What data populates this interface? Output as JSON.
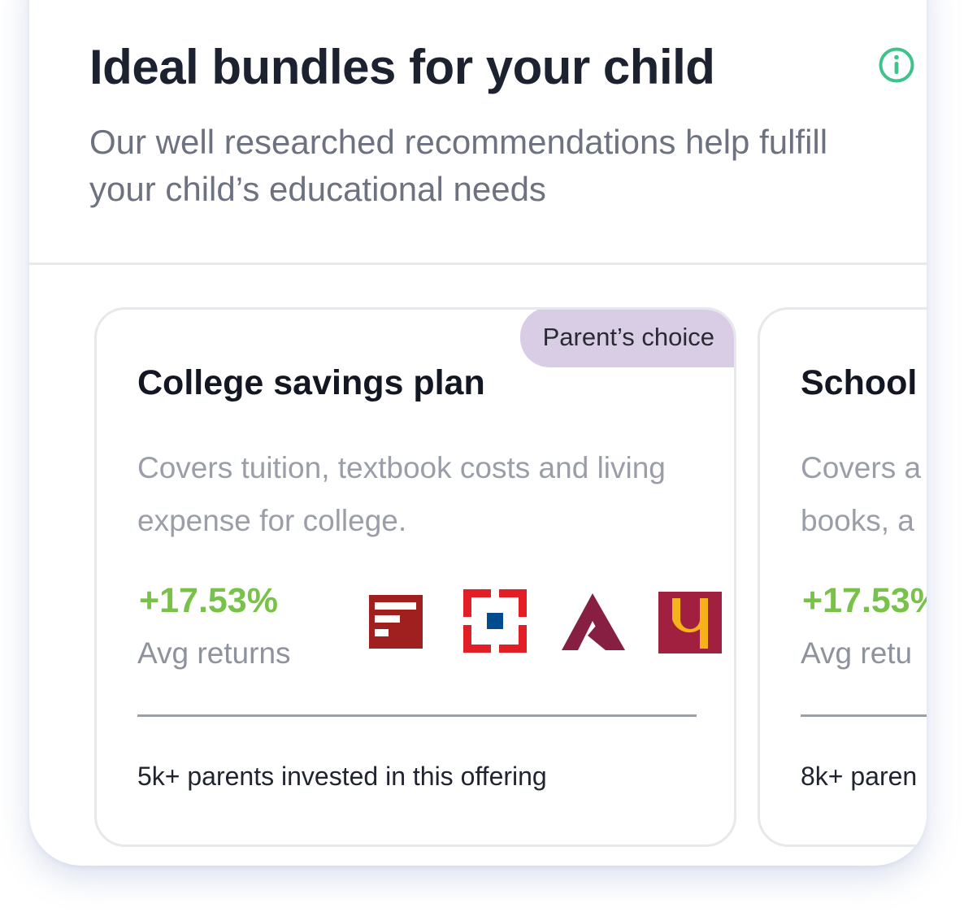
{
  "header": {
    "title": "Ideal bundles for your child",
    "subtitle": "Our well researched recommendations help fulfill your child’s educational needs",
    "info_icon": "info-circle-icon",
    "info_icon_color": "#3fc38a"
  },
  "cards": [
    {
      "badge": "Parent’s choice",
      "title": "College savings plan",
      "description": "Covers tuition, textbook costs and living expense for college.",
      "return_value": "+17.53%",
      "return_label": "Avg returns",
      "fund_logos": [
        "franklin-logo-icon",
        "hdfc-logo-icon",
        "axis-logo-icon",
        "pnb-logo-icon"
      ],
      "investors": "5k+ parents invested in this offering"
    },
    {
      "title": "School",
      "description_lines": [
        "Covers a",
        "books, a"
      ],
      "return_value": "+17.53%",
      "return_label": "Avg retu",
      "investors": "8k+ paren"
    }
  ],
  "colors": {
    "return_green": "#78c24a",
    "badge_purple": "#d9cde6",
    "title_dark": "#1c2230"
  }
}
